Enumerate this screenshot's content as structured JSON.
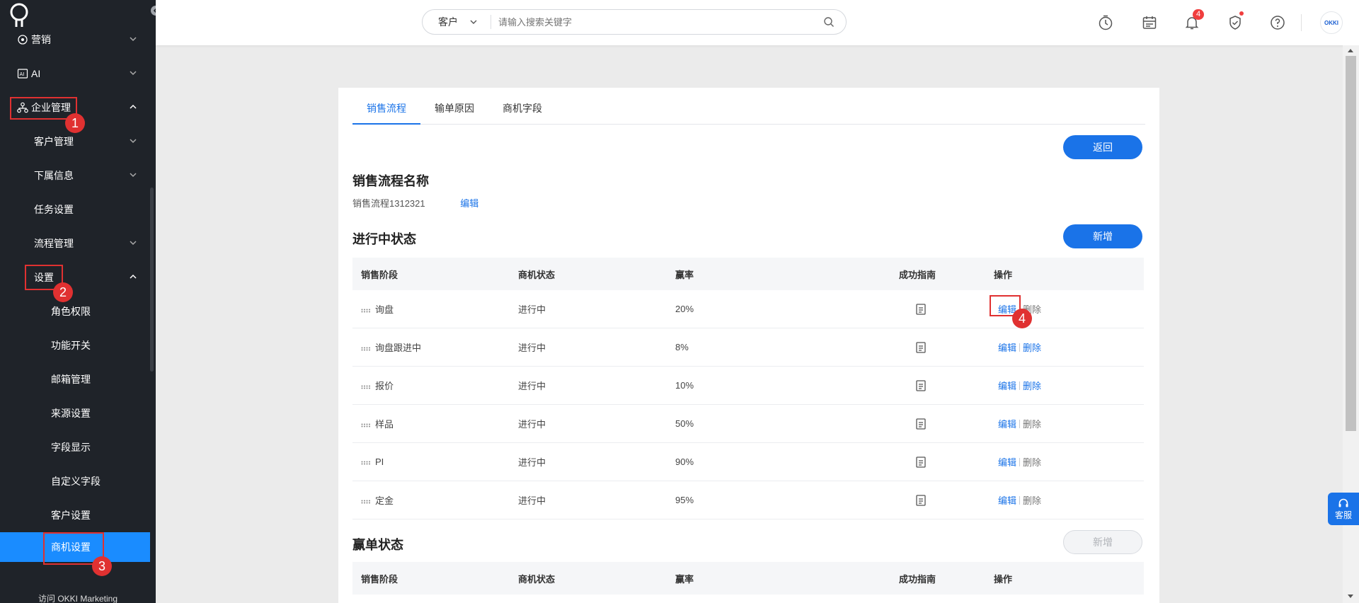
{
  "sidebar": {
    "items": [
      {
        "label": "营销"
      },
      {
        "label": "AI"
      },
      {
        "label": "企业管理"
      },
      {
        "label": "客户管理"
      },
      {
        "label": "下属信息"
      },
      {
        "label": "任务设置"
      },
      {
        "label": "流程管理"
      },
      {
        "label": "设置"
      },
      {
        "label": "角色权限"
      },
      {
        "label": "功能开关"
      },
      {
        "label": "邮箱管理"
      },
      {
        "label": "来源设置"
      },
      {
        "label": "字段显示"
      },
      {
        "label": "自定义字段"
      },
      {
        "label": "客户设置"
      },
      {
        "label": "商机设置"
      },
      {
        "label": "访问 OKKI Marketing"
      }
    ]
  },
  "annotations": [
    "1",
    "2",
    "3",
    "4"
  ],
  "search": {
    "category": "客户",
    "placeholder": "请输入搜索关键字"
  },
  "topbar": {
    "notification_count": "4",
    "avatar_text": "OKKI"
  },
  "tabs": [
    "销售流程",
    "输单原因",
    "商机字段"
  ],
  "buttons": {
    "back": "返回",
    "add": "新增",
    "add_won": "新增"
  },
  "flow": {
    "section_title": "销售流程名称",
    "name": "销售流程1312321",
    "edit": "编辑"
  },
  "in_progress": {
    "title": "进行中状态",
    "headers": [
      "销售阶段",
      "商机状态",
      "赢率",
      "成功指南",
      "操作"
    ],
    "rows": [
      {
        "stage": "询盘",
        "status": "进行中",
        "rate": "20%",
        "edit": "编辑",
        "delete": "删除"
      },
      {
        "stage": "询盘跟进中",
        "status": "进行中",
        "rate": "8%",
        "edit": "编辑",
        "delete": "删除"
      },
      {
        "stage": "报价",
        "status": "进行中",
        "rate": "10%",
        "edit": "编辑",
        "delete": "删除"
      },
      {
        "stage": "样品",
        "status": "进行中",
        "rate": "50%",
        "edit": "编辑",
        "delete": "删除"
      },
      {
        "stage": "PI",
        "status": "进行中",
        "rate": "90%",
        "edit": "编辑",
        "delete": "删除"
      },
      {
        "stage": "定金",
        "status": "进行中",
        "rate": "95%",
        "edit": "编辑",
        "delete": "删除"
      }
    ]
  },
  "won": {
    "title": "赢单状态",
    "headers": [
      "销售阶段",
      "商机状态",
      "赢率",
      "成功指南",
      "操作"
    ]
  },
  "service": {
    "label": "客服"
  },
  "colors": {
    "sidebar_bg": "#1f2329",
    "accent": "#1a73e8",
    "active_item": "#1a8cff",
    "annotation_red": "#e03131"
  }
}
